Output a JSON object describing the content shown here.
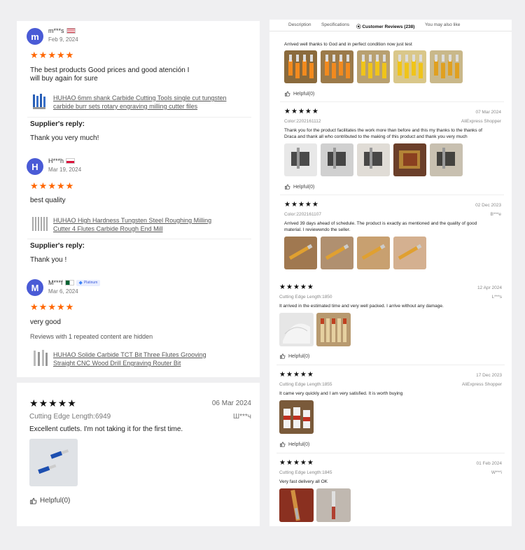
{
  "left_reviews": [
    {
      "avatar_letter": "m",
      "name": "m***s",
      "flag": "us",
      "date": "Feb 9, 2024",
      "text_line1": "The best products Good prices and good atención I",
      "text_line2": "will buy again for sure",
      "product_line1": "HUHAO 6mm shank Carbide Cutting Tools single cut tungsten",
      "product_line2": "carbide burr sets rotary engraving milling cutter files",
      "reply_heading": "Supplier's reply:",
      "reply": "Thank you very much!"
    },
    {
      "avatar_letter": "H",
      "name": "H***h",
      "flag": "pl",
      "date": "Mar 19, 2024",
      "text_line1": "best quality",
      "product_line1": "HUHAO High Hardness Tungsten Steel Roughing Milling",
      "product_line2": "Cutter 4 Flutes Carbide Rough End Mill",
      "reply_heading": "Supplier's reply:",
      "reply": "Thank you !"
    },
    {
      "avatar_letter": "M",
      "name": "M***f",
      "flag": "dz",
      "badge": "Platinum",
      "date": "Mar 6, 2024",
      "text_line1": "very good",
      "note": "Reviews with 1 repeated content are hidden",
      "product_line1": "HUHAO Solide Carbide TCT Bit Three Flutes Grooving",
      "product_line2": "Straight CNC Wood Drill Engraving Router Bit"
    }
  ],
  "left_bottom_review": {
    "date": "06 Mar 2024",
    "variant": "Cutting Edge Length:6949",
    "author": "Ш***ч",
    "text": "Excellent cutlets. I'm not taking it for the first time.",
    "helpful": "Helpful(0)"
  },
  "tabs": {
    "t1": "Description",
    "t2": "Specifications",
    "t3": "Customer Reviews (238)",
    "t4": "You may also like"
  },
  "right_reviews_top": [
    {
      "text": "Arrived well thanks to God and in perfect condition now just test",
      "helpful": "Helpful(0)"
    },
    {
      "date": "07 Mar 2024",
      "variant": "Color:2202161112",
      "author": "AliExpress Shopper",
      "text_line1": "Thank you for the product facilitates the work more than before and this my thanks to the thanks of",
      "text_line2": "Draca and thank all who contributed to the making of this product and thank you very much",
      "helpful": "Helpful(0)"
    },
    {
      "date": "02 Dec 2023",
      "variant": "Color:2202161107",
      "author": "B***e",
      "text_line1": "Arrived 39 days ahead of schedule. The product is exactly as mentioned and the quality of good",
      "text_line2": "material. I reviewwndo the seller."
    }
  ],
  "right_reviews_bottom": [
    {
      "date": "12 Apr 2024",
      "variant": "Cutting Edge Length:1850",
      "author": "L***s",
      "text": "It arrived in the estimated time and very well packed. I arrive without any damage.",
      "helpful": "Helpful(0)"
    },
    {
      "date": "17 Dec 2023",
      "variant": "Cutting Edge Length:1855",
      "author": "AliExpress Shopper",
      "text": "It came very quickly and I am very satisfied. It is worth buying",
      "helpful": "Helpful(0)"
    },
    {
      "date": "01 Feb 2024",
      "variant": "Cutting Edge Length:1845",
      "author": "W***i",
      "text": "Very fast delivery all OK"
    }
  ],
  "colors": {
    "star_orange": "#ff6600",
    "avatar_blue": "#4a5bd6",
    "badge_blue": "#3b5bdb"
  },
  "icons": [
    "star-icon",
    "thumb-up-icon",
    "location-pin-icon",
    "diamond-icon"
  ]
}
